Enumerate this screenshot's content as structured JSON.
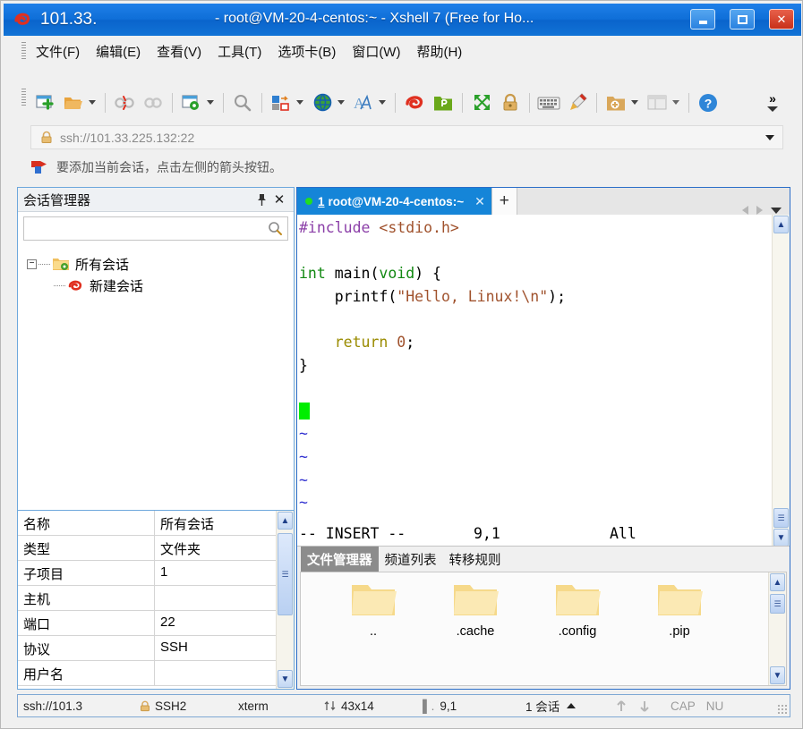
{
  "titlebar": {
    "left_label": "101.33.",
    "main_label": "- root@VM-20-4-centos:~ - Xshell 7 (Free for Ho...",
    "minimize": "–",
    "maximize": "□",
    "close": "✕"
  },
  "menubar": {
    "items": [
      {
        "label": "文件(F)",
        "name": "menu-file"
      },
      {
        "label": "编辑(E)",
        "name": "menu-edit"
      },
      {
        "label": "查看(V)",
        "name": "menu-view"
      },
      {
        "label": "工具(T)",
        "name": "menu-tools"
      },
      {
        "label": "选项卡(B)",
        "name": "menu-tabs"
      },
      {
        "label": "窗口(W)",
        "name": "menu-window"
      },
      {
        "label": "帮助(H)",
        "name": "menu-help"
      }
    ]
  },
  "toolbar": {
    "overflow_label": "»"
  },
  "address": {
    "value": "ssh://101.33.225.132:22",
    "lock_icon": "lock-icon"
  },
  "notify": {
    "text": "要添加当前会话，点击左侧的箭头按钮。"
  },
  "session_manager": {
    "title": "会话管理器",
    "pin": "⚓",
    "close": "✕",
    "search_placeholder": "",
    "tree": {
      "root_label": "所有会话",
      "expander": "−",
      "child_label": "新建会话"
    },
    "properties": [
      {
        "key": "名称",
        "value": "所有会话"
      },
      {
        "key": "类型",
        "value": "文件夹"
      },
      {
        "key": "子项目",
        "value": "1"
      },
      {
        "key": "主机",
        "value": ""
      },
      {
        "key": "端口",
        "value": "22"
      },
      {
        "key": "协议",
        "value": "SSH"
      },
      {
        "key": "用户名",
        "value": ""
      }
    ]
  },
  "terminal": {
    "tab": {
      "index": "1",
      "title": "root@VM-20-4-centos:~",
      "close": "✕",
      "add": "+"
    },
    "lines": [
      {
        "type": "code",
        "segments": [
          {
            "text": "#include",
            "cls": "c-pre"
          },
          {
            "text": " ",
            "cls": ""
          },
          {
            "text": "<stdio.h>",
            "cls": "c-inc"
          }
        ]
      },
      {
        "type": "blank",
        "segments": []
      },
      {
        "type": "code",
        "segments": [
          {
            "text": "int",
            "cls": "c-type"
          },
          {
            "text": " main(",
            "cls": ""
          },
          {
            "text": "void",
            "cls": "c-type"
          },
          {
            "text": ") {",
            "cls": ""
          }
        ]
      },
      {
        "type": "code",
        "segments": [
          {
            "text": "    printf(",
            "cls": ""
          },
          {
            "text": "\"Hello, Linux!\\n\"",
            "cls": "c-str"
          },
          {
            "text": ");",
            "cls": ""
          }
        ]
      },
      {
        "type": "blank",
        "segments": []
      },
      {
        "type": "code",
        "segments": [
          {
            "text": "    ",
            "cls": ""
          },
          {
            "text": "return",
            "cls": "c-kw"
          },
          {
            "text": " ",
            "cls": ""
          },
          {
            "text": "0",
            "cls": "c-num"
          },
          {
            "text": ";",
            "cls": ""
          }
        ]
      },
      {
        "type": "code",
        "segments": [
          {
            "text": "}",
            "cls": ""
          }
        ]
      },
      {
        "type": "blank",
        "segments": []
      },
      {
        "type": "cursor",
        "segments": []
      },
      {
        "type": "tilde",
        "segments": [
          {
            "text": "~",
            "cls": "c-tilde"
          }
        ]
      },
      {
        "type": "tilde",
        "segments": [
          {
            "text": "~",
            "cls": "c-tilde"
          }
        ]
      },
      {
        "type": "tilde",
        "segments": [
          {
            "text": "~",
            "cls": "c-tilde"
          }
        ]
      },
      {
        "type": "tilde",
        "segments": [
          {
            "text": "~",
            "cls": "c-tilde"
          }
        ]
      }
    ],
    "status": {
      "mode": "-- INSERT --",
      "position": "9,1",
      "scroll": "All"
    }
  },
  "file_panel": {
    "tabs": [
      {
        "label": "文件管理器",
        "active": true,
        "name": "tab-file-manager"
      },
      {
        "label": "频道列表",
        "active": false,
        "name": "tab-channel-list"
      },
      {
        "label": "转移规则",
        "active": false,
        "name": "tab-transfer-rules"
      }
    ],
    "items": [
      {
        "name": "..",
        "icon": "folder-icon"
      },
      {
        "name": ".cache",
        "icon": "folder-icon"
      },
      {
        "name": ".config",
        "icon": "folder-icon"
      },
      {
        "name": ".pip",
        "icon": "folder-icon"
      }
    ]
  },
  "statusbar": {
    "url": "ssh://101.3",
    "protocol": "SSH2",
    "term_type": "xterm",
    "size": "43x14",
    "position": "9,1",
    "sessions": "1 会话",
    "caps": "CAP",
    "num": "NU"
  },
  "colors": {
    "title_blue": "#0f6fd8",
    "tab_blue": "#1585d8",
    "accent_border": "#2b6ec9",
    "cursor_green": "#00ee00",
    "preproc_purple": "#8b3fa8",
    "type_green": "#118811",
    "string_brown": "#a0522d",
    "keyword_olive": "#9a8b00",
    "tilde_blue": "#3030d0"
  }
}
